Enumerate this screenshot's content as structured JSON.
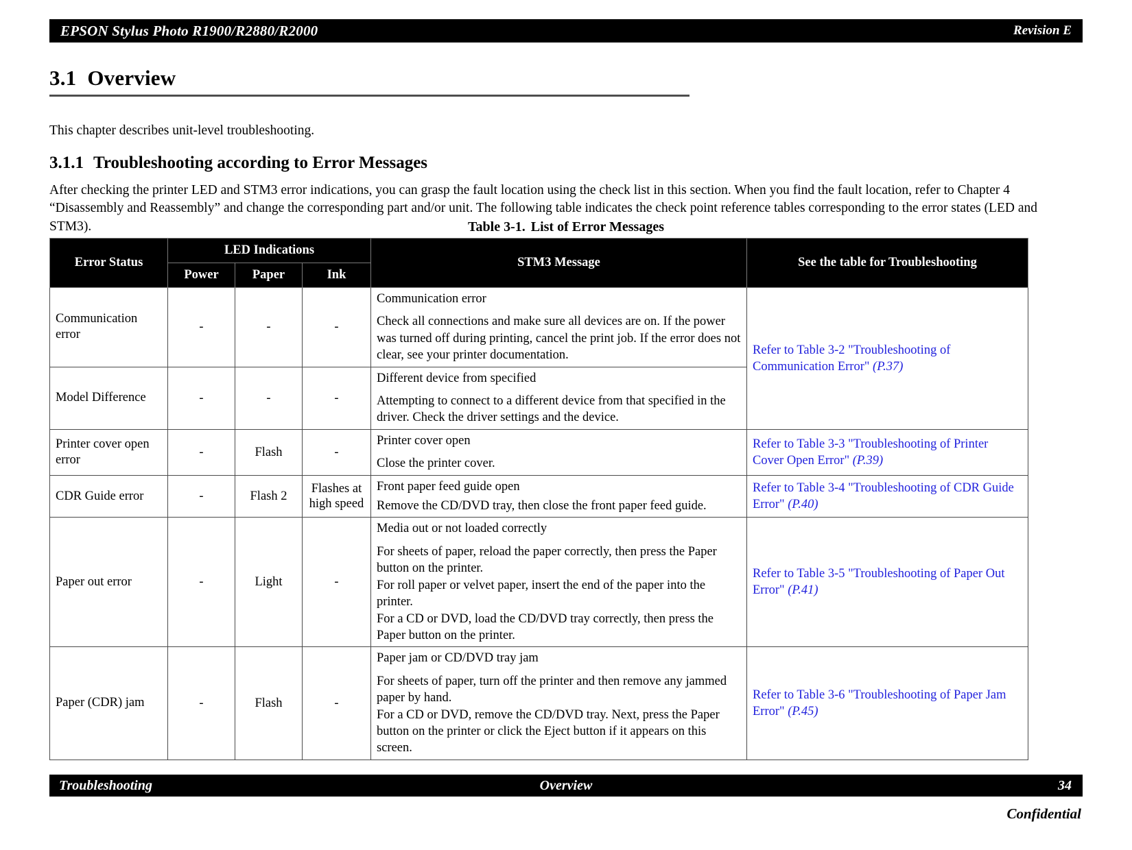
{
  "header": {
    "left_title": "EPSON Stylus Photo R1900/R2880/R2000",
    "right_revision": "Revision E"
  },
  "section": {
    "number": "3.1",
    "title": "Overview",
    "intro": "This chapter describes unit-level troubleshooting.",
    "sub_number": "3.1.1",
    "sub_title": "Troubleshooting according to Error Messages",
    "body": "After checking the printer LED and STM3 error indications, you can grasp the fault location using the check list in this section. When you find the fault location, refer to Chapter 4 “Disassembly and Reassembly” and change the corresponding part and/or unit. The following table indicates the check point reference tables corresponding to the error states (LED and STM3)."
  },
  "table": {
    "caption_label": "Table 3-1.",
    "caption_title": "List of Error Messages",
    "headers": {
      "error_status": "Error Status",
      "led_indications": "LED Indications",
      "power": "Power",
      "paper": "Paper",
      "ink": "Ink",
      "stm3_message": "STM3 Message",
      "see_table": "See the table for Troubleshooting"
    },
    "rows": [
      {
        "status": "Communication error",
        "power": "-",
        "paper": "-",
        "ink": "-",
        "stm3_title": "Communication error",
        "stm3_body": "Check all connections and make sure all devices are on. If the power was turned off during printing, cancel the print job. If the error does not clear, see your printer documentation."
      },
      {
        "status": "Model Difference",
        "power": "-",
        "paper": "-",
        "ink": "-",
        "stm3_title": "Different device from specified",
        "stm3_body": "Attempting to connect to a different device from that specified in the driver. Check the driver settings and the device."
      },
      {
        "status": "Printer cover open error",
        "power": "-",
        "paper": "Flash",
        "ink": "-",
        "stm3_title": "Printer cover open",
        "stm3_body": "Close the printer cover."
      },
      {
        "status": "CDR Guide error",
        "power": "-",
        "paper": "Flash 2",
        "ink": "Flashes at high speed",
        "stm3_title": "Front paper feed guide open",
        "stm3_body": "Remove the CD/DVD tray, then close the front paper feed guide."
      },
      {
        "status": "Paper out error",
        "power": "-",
        "paper": "Light",
        "ink": "-",
        "stm3_title": "Media out or not loaded correctly",
        "stm3_body": "For sheets of paper, reload the paper correctly, then press the Paper button on the printer.\nFor roll paper or velvet paper, insert the end of the paper into the printer.\nFor a CD or DVD, load the CD/DVD tray correctly, then press the Paper button on the printer."
      },
      {
        "status": "Paper (CDR) jam",
        "power": "-",
        "paper": "Flash",
        "ink": "-",
        "stm3_title": "Paper jam or CD/DVD tray jam",
        "stm3_body": "For sheets of paper, turn off the printer and then remove any jammed paper by hand.\nFor a CD or DVD, remove the CD/DVD tray. Next, press the Paper button on the printer or click the Eject button if it appears on this screen."
      }
    ],
    "references": [
      {
        "text": "Refer to Table 3-2 \"Troubleshooting of Communication Error\"",
        "page": "(P.37)",
        "rowspan": 2
      },
      {
        "text": "Refer to Table 3-3 \"Troubleshooting of Printer Cover Open Error\"",
        "page": "(P.39)",
        "rowspan": 1
      },
      {
        "text": "Refer to Table 3-4 \"Troubleshooting of CDR Guide Error\"",
        "page": "(P.40)",
        "rowspan": 1
      },
      {
        "text": "Refer to Table 3-5 \"Troubleshooting of Paper Out Error\"",
        "page": "(P.41)",
        "rowspan": 1
      },
      {
        "text": "Refer to Table 3-6 \"Troubleshooting of Paper Jam Error\"",
        "page": "(P.45)",
        "rowspan": 1
      }
    ],
    "link_color": "#2222dd"
  },
  "footer": {
    "left": "Troubleshooting",
    "center": "Overview",
    "page_number": "34",
    "confidential": "Confidential"
  }
}
